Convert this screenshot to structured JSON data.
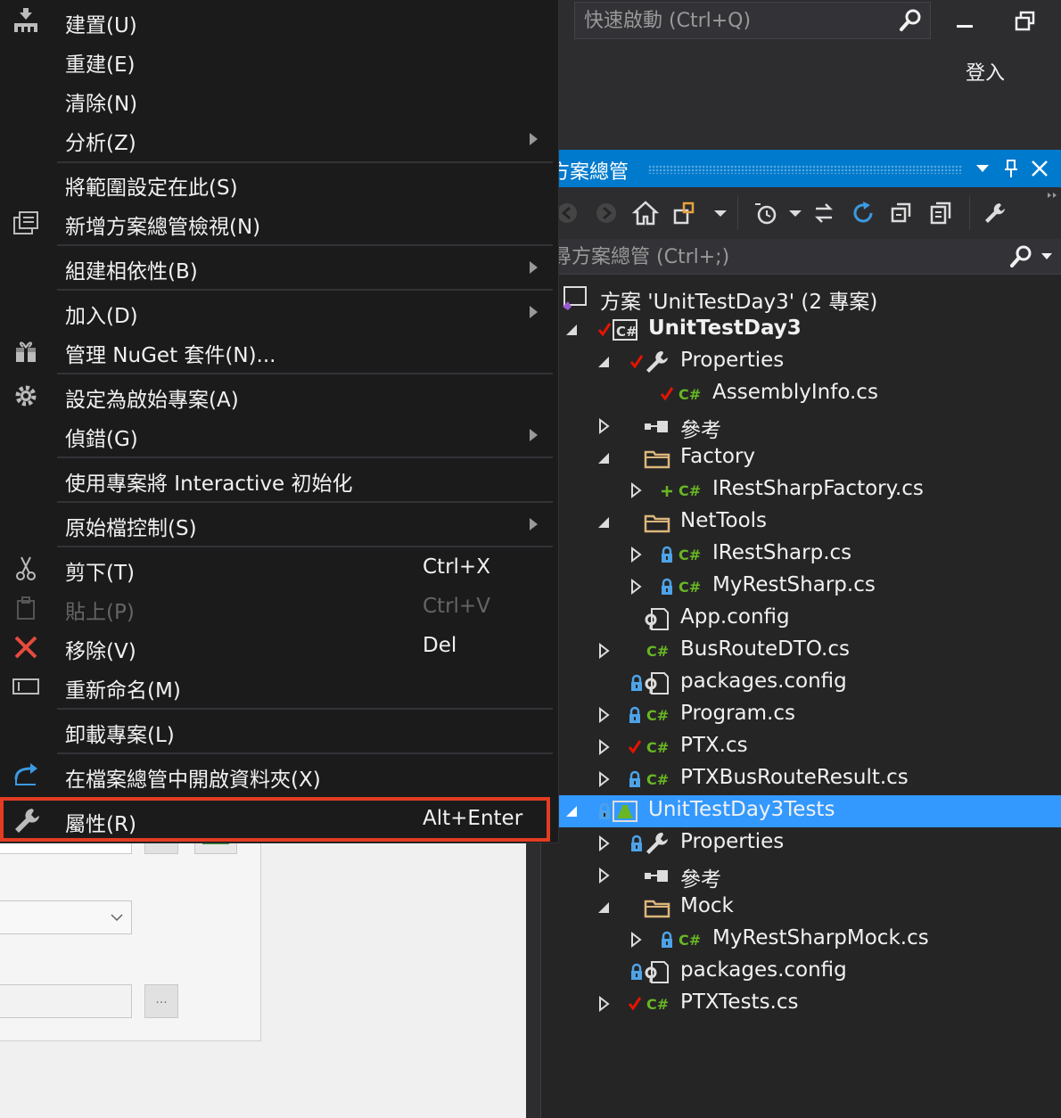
{
  "top_bar": {
    "quick_launch_placeholder": "快速啟動 (Ctrl+Q)",
    "signin_label": "登入"
  },
  "solution_explorer": {
    "title": "方案總管",
    "search_placeholder": "搜尋方案總管 (Ctrl+;)",
    "tree": [
      {
        "label": "方案 'UnitTestDay3' (2 專案)",
        "icon": "solution-icon",
        "status": "",
        "bold": false,
        "expander": "none"
      },
      {
        "label": "UnitTestDay3",
        "icon": "csharp-project-icon",
        "status": "checked-in",
        "bold": true,
        "expander": "expanded"
      },
      {
        "label": "Properties",
        "icon": "wrench-icon",
        "status": "checked-in",
        "bold": false,
        "expander": "expanded"
      },
      {
        "label": "AssemblyInfo.cs",
        "icon": "csharp-file-icon",
        "status": "checked-in",
        "bold": false,
        "expander": "none"
      },
      {
        "label": "參考",
        "icon": "references-icon",
        "status": "",
        "bold": false,
        "expander": "collapsed"
      },
      {
        "label": "Factory",
        "icon": "folder-icon",
        "status": "",
        "bold": false,
        "expander": "expanded"
      },
      {
        "label": "IRestSharpFactory.cs",
        "icon": "csharp-file-icon",
        "status": "added",
        "bold": false,
        "expander": "collapsed"
      },
      {
        "label": "NetTools",
        "icon": "folder-icon",
        "status": "",
        "bold": false,
        "expander": "expanded"
      },
      {
        "label": "IRestSharp.cs",
        "icon": "csharp-file-icon",
        "status": "locked",
        "bold": false,
        "expander": "collapsed"
      },
      {
        "label": "MyRestSharp.cs",
        "icon": "csharp-file-icon",
        "status": "locked",
        "bold": false,
        "expander": "collapsed"
      },
      {
        "label": "App.config",
        "icon": "config-file-icon",
        "status": "",
        "bold": false,
        "expander": "none"
      },
      {
        "label": "BusRouteDTO.cs",
        "icon": "csharp-file-icon",
        "status": "",
        "bold": false,
        "expander": "collapsed"
      },
      {
        "label": "packages.config",
        "icon": "config-file-icon",
        "status": "locked",
        "bold": false,
        "expander": "none"
      },
      {
        "label": "Program.cs",
        "icon": "csharp-file-icon",
        "status": "locked",
        "bold": false,
        "expander": "collapsed"
      },
      {
        "label": "PTX.cs",
        "icon": "csharp-file-icon",
        "status": "checked-in",
        "bold": false,
        "expander": "collapsed"
      },
      {
        "label": "PTXBusRouteResult.cs",
        "icon": "csharp-file-icon",
        "status": "locked",
        "bold": false,
        "expander": "collapsed"
      },
      {
        "label": "UnitTestDay3Tests",
        "icon": "test-project-icon",
        "status": "locked",
        "bold": false,
        "expander": "expanded",
        "selected": true
      },
      {
        "label": "Properties",
        "icon": "wrench-icon",
        "status": "locked",
        "bold": false,
        "expander": "collapsed"
      },
      {
        "label": "參考",
        "icon": "references-icon",
        "status": "",
        "bold": false,
        "expander": "collapsed"
      },
      {
        "label": "Mock",
        "icon": "folder-icon",
        "status": "",
        "bold": false,
        "expander": "expanded"
      },
      {
        "label": "MyRestSharpMock.cs",
        "icon": "csharp-file-icon",
        "status": "locked",
        "bold": false,
        "expander": "collapsed"
      },
      {
        "label": "packages.config",
        "icon": "config-file-icon",
        "status": "locked",
        "bold": false,
        "expander": "none"
      },
      {
        "label": "PTXTests.cs",
        "icon": "csharp-file-icon",
        "status": "checked-in",
        "bold": false,
        "expander": "collapsed"
      }
    ]
  },
  "context_menu": {
    "items": [
      {
        "label": "建置(U)",
        "icon": "build-icon",
        "shortcut": "",
        "submenu": false,
        "disabled": false
      },
      {
        "label": "重建(E)",
        "icon": "",
        "shortcut": "",
        "submenu": false,
        "disabled": false
      },
      {
        "label": "清除(N)",
        "icon": "",
        "shortcut": "",
        "submenu": false,
        "disabled": false
      },
      {
        "label": "分析(Z)",
        "icon": "",
        "shortcut": "",
        "submenu": true,
        "disabled": false
      },
      {
        "label": "將範圍設定在此(S)",
        "icon": "",
        "shortcut": "",
        "submenu": false,
        "disabled": false
      },
      {
        "label": "新增方案總管檢視(N)",
        "icon": "new-view-icon",
        "shortcut": "",
        "submenu": false,
        "disabled": false
      },
      {
        "label": "組建相依性(B)",
        "icon": "",
        "shortcut": "",
        "submenu": true,
        "disabled": false
      },
      {
        "label": "加入(D)",
        "icon": "",
        "shortcut": "",
        "submenu": true,
        "disabled": false
      },
      {
        "label": "管理 NuGet 套件(N)...",
        "icon": "nuget-package-icon",
        "shortcut": "",
        "submenu": false,
        "disabled": false
      },
      {
        "label": "設定為啟始專案(A)",
        "icon": "gear-icon",
        "shortcut": "",
        "submenu": false,
        "disabled": false
      },
      {
        "label": "偵錯(G)",
        "icon": "",
        "shortcut": "",
        "submenu": true,
        "disabled": false
      },
      {
        "label": "使用專案將 Interactive 初始化",
        "icon": "",
        "shortcut": "",
        "submenu": false,
        "disabled": false
      },
      {
        "label": "原始檔控制(S)",
        "icon": "",
        "shortcut": "",
        "submenu": true,
        "disabled": false
      },
      {
        "label": "剪下(T)",
        "icon": "scissors-icon",
        "shortcut": "Ctrl+X",
        "submenu": false,
        "disabled": false
      },
      {
        "label": "貼上(P)",
        "icon": "paste-icon",
        "shortcut": "Ctrl+V",
        "submenu": false,
        "disabled": true
      },
      {
        "label": "移除(V)",
        "icon": "remove-x-icon",
        "shortcut": "Del",
        "submenu": false,
        "disabled": false
      },
      {
        "label": "重新命名(M)",
        "icon": "rename-icon",
        "shortcut": "",
        "submenu": false,
        "disabled": false
      },
      {
        "label": "卸載專案(L)",
        "icon": "",
        "shortcut": "",
        "submenu": false,
        "disabled": false
      },
      {
        "label": "在檔案總管中開啟資料夾(X)",
        "icon": "open-folder-arrow-icon",
        "shortcut": "",
        "submenu": false,
        "disabled": false
      },
      {
        "label": "屬性(R)",
        "icon": "wrench-icon",
        "shortcut": "Alt+Enter",
        "submenu": false,
        "disabled": false,
        "highlighted": true
      }
    ]
  },
  "background_form": {
    "browse_button_label": "..."
  },
  "colors": {
    "accent": "#007acc",
    "selection": "#3399ff",
    "highlight_box": "#e33c22",
    "check_red": "#e51400",
    "csharp_green": "#68b723",
    "lock_blue": "#4da3e8"
  }
}
